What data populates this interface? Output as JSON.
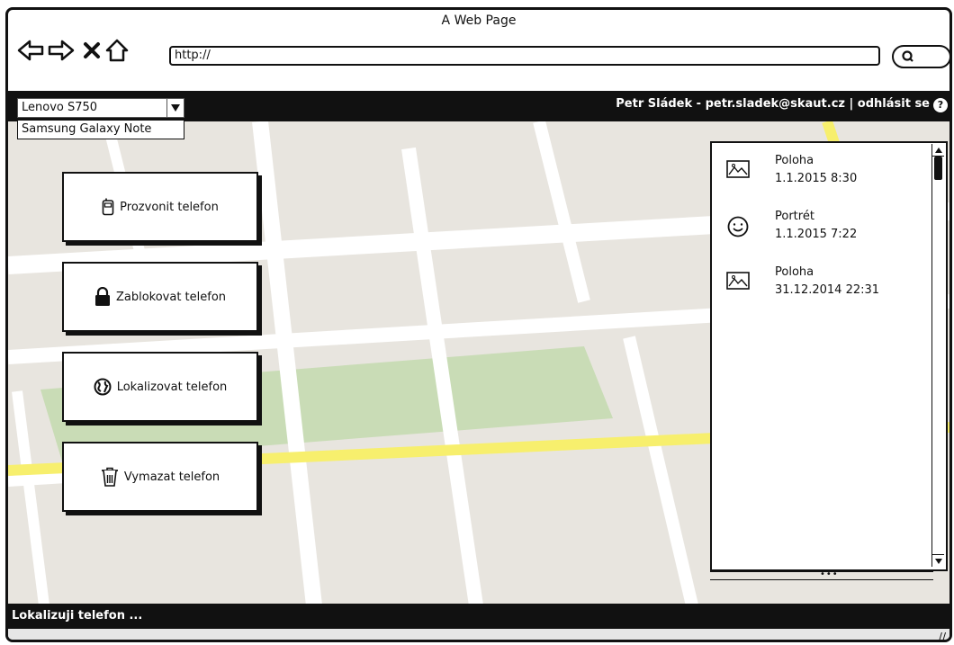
{
  "window": {
    "title": "A Web Page"
  },
  "browser": {
    "url": "http://"
  },
  "header": {
    "device_selected": "Lenovo S750",
    "device_options": [
      "Samsung Galaxy Note"
    ],
    "user_text": "Petr Sládek - petr.sladek@skaut.cz | odhlásit se",
    "help_glyph": "?"
  },
  "actions": [
    {
      "label": "Prozvonit telefon",
      "icon": "phone-icon"
    },
    {
      "label": "Zablokovat telefon",
      "icon": "lock-icon"
    },
    {
      "label": "Lokalizovat telefon",
      "icon": "globe-icon"
    },
    {
      "label": "Vymazat telefon",
      "icon": "trash-icon"
    }
  ],
  "history": [
    {
      "title": "Poloha",
      "time": "1.1.2015 8:30",
      "icon": "image-icon"
    },
    {
      "title": "Portrét",
      "time": "1.1.2015 7:22",
      "icon": "smiley-icon"
    },
    {
      "title": "Poloha",
      "time": "31.12.2014 22:31",
      "icon": "image-icon"
    }
  ],
  "status": {
    "text": "Lokalizuji telefon ..."
  },
  "colors": {
    "map_bg": "#e8e5df",
    "road": "#ffffff",
    "park": "#c9dcb6",
    "highway": "#f7ef6d",
    "bar": "#111111"
  }
}
